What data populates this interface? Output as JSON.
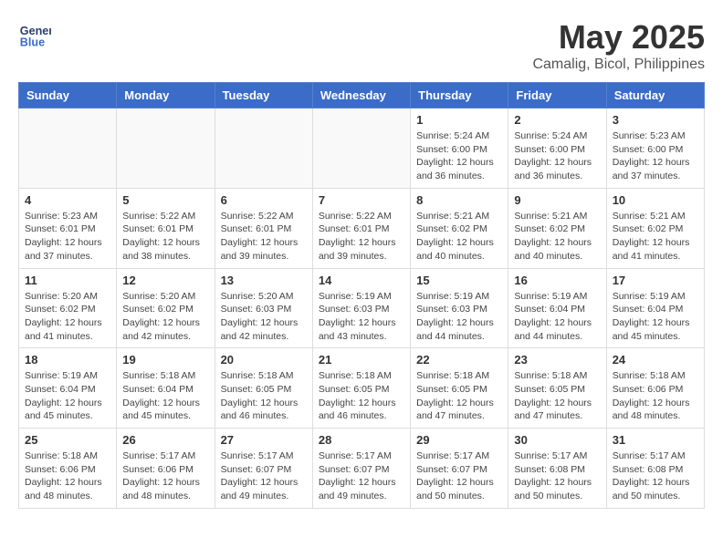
{
  "header": {
    "logo_line1": "General",
    "logo_line2": "Blue",
    "month_year": "May 2025",
    "location": "Camalig, Bicol, Philippines"
  },
  "weekdays": [
    "Sunday",
    "Monday",
    "Tuesday",
    "Wednesday",
    "Thursday",
    "Friday",
    "Saturday"
  ],
  "weeks": [
    [
      {
        "day": "",
        "info": ""
      },
      {
        "day": "",
        "info": ""
      },
      {
        "day": "",
        "info": ""
      },
      {
        "day": "",
        "info": ""
      },
      {
        "day": "1",
        "info": "Sunrise: 5:24 AM\nSunset: 6:00 PM\nDaylight: 12 hours\nand 36 minutes."
      },
      {
        "day": "2",
        "info": "Sunrise: 5:24 AM\nSunset: 6:00 PM\nDaylight: 12 hours\nand 36 minutes."
      },
      {
        "day": "3",
        "info": "Sunrise: 5:23 AM\nSunset: 6:00 PM\nDaylight: 12 hours\nand 37 minutes."
      }
    ],
    [
      {
        "day": "4",
        "info": "Sunrise: 5:23 AM\nSunset: 6:01 PM\nDaylight: 12 hours\nand 37 minutes."
      },
      {
        "day": "5",
        "info": "Sunrise: 5:22 AM\nSunset: 6:01 PM\nDaylight: 12 hours\nand 38 minutes."
      },
      {
        "day": "6",
        "info": "Sunrise: 5:22 AM\nSunset: 6:01 PM\nDaylight: 12 hours\nand 39 minutes."
      },
      {
        "day": "7",
        "info": "Sunrise: 5:22 AM\nSunset: 6:01 PM\nDaylight: 12 hours\nand 39 minutes."
      },
      {
        "day": "8",
        "info": "Sunrise: 5:21 AM\nSunset: 6:02 PM\nDaylight: 12 hours\nand 40 minutes."
      },
      {
        "day": "9",
        "info": "Sunrise: 5:21 AM\nSunset: 6:02 PM\nDaylight: 12 hours\nand 40 minutes."
      },
      {
        "day": "10",
        "info": "Sunrise: 5:21 AM\nSunset: 6:02 PM\nDaylight: 12 hours\nand 41 minutes."
      }
    ],
    [
      {
        "day": "11",
        "info": "Sunrise: 5:20 AM\nSunset: 6:02 PM\nDaylight: 12 hours\nand 41 minutes."
      },
      {
        "day": "12",
        "info": "Sunrise: 5:20 AM\nSunset: 6:02 PM\nDaylight: 12 hours\nand 42 minutes."
      },
      {
        "day": "13",
        "info": "Sunrise: 5:20 AM\nSunset: 6:03 PM\nDaylight: 12 hours\nand 42 minutes."
      },
      {
        "day": "14",
        "info": "Sunrise: 5:19 AM\nSunset: 6:03 PM\nDaylight: 12 hours\nand 43 minutes."
      },
      {
        "day": "15",
        "info": "Sunrise: 5:19 AM\nSunset: 6:03 PM\nDaylight: 12 hours\nand 44 minutes."
      },
      {
        "day": "16",
        "info": "Sunrise: 5:19 AM\nSunset: 6:04 PM\nDaylight: 12 hours\nand 44 minutes."
      },
      {
        "day": "17",
        "info": "Sunrise: 5:19 AM\nSunset: 6:04 PM\nDaylight: 12 hours\nand 45 minutes."
      }
    ],
    [
      {
        "day": "18",
        "info": "Sunrise: 5:19 AM\nSunset: 6:04 PM\nDaylight: 12 hours\nand 45 minutes."
      },
      {
        "day": "19",
        "info": "Sunrise: 5:18 AM\nSunset: 6:04 PM\nDaylight: 12 hours\nand 45 minutes."
      },
      {
        "day": "20",
        "info": "Sunrise: 5:18 AM\nSunset: 6:05 PM\nDaylight: 12 hours\nand 46 minutes."
      },
      {
        "day": "21",
        "info": "Sunrise: 5:18 AM\nSunset: 6:05 PM\nDaylight: 12 hours\nand 46 minutes."
      },
      {
        "day": "22",
        "info": "Sunrise: 5:18 AM\nSunset: 6:05 PM\nDaylight: 12 hours\nand 47 minutes."
      },
      {
        "day": "23",
        "info": "Sunrise: 5:18 AM\nSunset: 6:05 PM\nDaylight: 12 hours\nand 47 minutes."
      },
      {
        "day": "24",
        "info": "Sunrise: 5:18 AM\nSunset: 6:06 PM\nDaylight: 12 hours\nand 48 minutes."
      }
    ],
    [
      {
        "day": "25",
        "info": "Sunrise: 5:18 AM\nSunset: 6:06 PM\nDaylight: 12 hours\nand 48 minutes."
      },
      {
        "day": "26",
        "info": "Sunrise: 5:17 AM\nSunset: 6:06 PM\nDaylight: 12 hours\nand 48 minutes."
      },
      {
        "day": "27",
        "info": "Sunrise: 5:17 AM\nSunset: 6:07 PM\nDaylight: 12 hours\nand 49 minutes."
      },
      {
        "day": "28",
        "info": "Sunrise: 5:17 AM\nSunset: 6:07 PM\nDaylight: 12 hours\nand 49 minutes."
      },
      {
        "day": "29",
        "info": "Sunrise: 5:17 AM\nSunset: 6:07 PM\nDaylight: 12 hours\nand 50 minutes."
      },
      {
        "day": "30",
        "info": "Sunrise: 5:17 AM\nSunset: 6:08 PM\nDaylight: 12 hours\nand 50 minutes."
      },
      {
        "day": "31",
        "info": "Sunrise: 5:17 AM\nSunset: 6:08 PM\nDaylight: 12 hours\nand 50 minutes."
      }
    ]
  ]
}
